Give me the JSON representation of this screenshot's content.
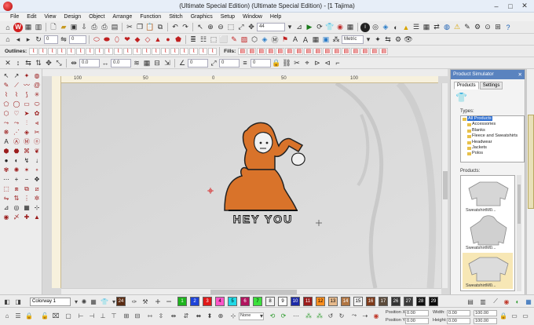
{
  "window": {
    "title": "(Ultimate Special Edition) (Ultimate Special Edition) - [1           Tajima)",
    "controls": [
      "–",
      "□",
      "✕"
    ]
  },
  "menu": [
    "File",
    "Edit",
    "View",
    "Design",
    "Object",
    "Arrange",
    "Function",
    "Stitch",
    "Graphics",
    "Setup",
    "Window",
    "Help"
  ],
  "toolbar1": {
    "zoom_value": "44",
    "metric_value": "Metric",
    "count_value": "0"
  },
  "toolbar3": {
    "outlines_label": "Outlines:",
    "fills_label": "Fills:",
    "field_a": "0.0",
    "field_b": "0.0",
    "field_c": "0.0"
  },
  "toolbar4": {
    "field_a": "0.0",
    "field_b": "0.0",
    "field_c": "0",
    "field_d": "0",
    "field_e": "0"
  },
  "ruler": {
    "marks": [
      "100",
      "50",
      "0",
      "50",
      "100"
    ]
  },
  "canvas": {
    "design_text": "HEY YOU",
    "garment_color": "#dcdcdc"
  },
  "panel": {
    "title": "Product Simulator",
    "tab_products": "Products",
    "tab_settings": "Settings",
    "types_label": "Types:",
    "types": [
      "All Products",
      "Accessories",
      "Blanks",
      "Fleece and Sweatshirts",
      "Headwear",
      "Jackets",
      "Polos"
    ],
    "products_label": "Products:",
    "products": [
      "SweatshirtM0...",
      "SweatshirtM0...",
      "SweatshirtM0..."
    ]
  },
  "palette": {
    "colorway": "Colorway 1",
    "swatches": [
      {
        "n": "24",
        "c": "#5a2b12"
      },
      {
        "n": "1",
        "c": "#1db41d"
      },
      {
        "n": "2",
        "c": "#1d43d8"
      },
      {
        "n": "3",
        "c": "#e01818"
      },
      {
        "n": "4",
        "c": "#ff55c8"
      },
      {
        "n": "5",
        "c": "#21d9e6"
      },
      {
        "n": "6",
        "c": "#b1155f"
      },
      {
        "n": "7",
        "c": "#3be03b"
      },
      {
        "n": "8",
        "c": "#f2f2f2"
      },
      {
        "n": "9",
        "c": "#ffffff"
      },
      {
        "n": "10",
        "c": "#1c2aa7"
      },
      {
        "n": "11",
        "c": "#9c1c1c"
      },
      {
        "n": "12",
        "c": "#ff8f1f"
      },
      {
        "n": "13",
        "c": "#e6b98b"
      },
      {
        "n": "14",
        "c": "#b07542"
      },
      {
        "n": "15",
        "c": "#f3f3f3"
      },
      {
        "n": "16",
        "c": "#7e3a1a"
      },
      {
        "n": "17",
        "c": "#5b4a3a"
      },
      {
        "n": "26",
        "c": "#333333"
      },
      {
        "n": "27",
        "c": "#3a3a3a"
      },
      {
        "n": "28",
        "c": "#111111"
      },
      {
        "n": "29",
        "c": "#0a0a0a"
      }
    ]
  },
  "statusbar": {
    "none_value": "None",
    "position_x_label": "Position X:",
    "position_y_label": "Position Y:",
    "width_label": "Width:",
    "height_label": "Height:",
    "position_x": "0.00",
    "position_y": "0.00",
    "width": "0.00",
    "height": "0.00",
    "width_pct": "100.00",
    "height_pct": "100.00"
  }
}
